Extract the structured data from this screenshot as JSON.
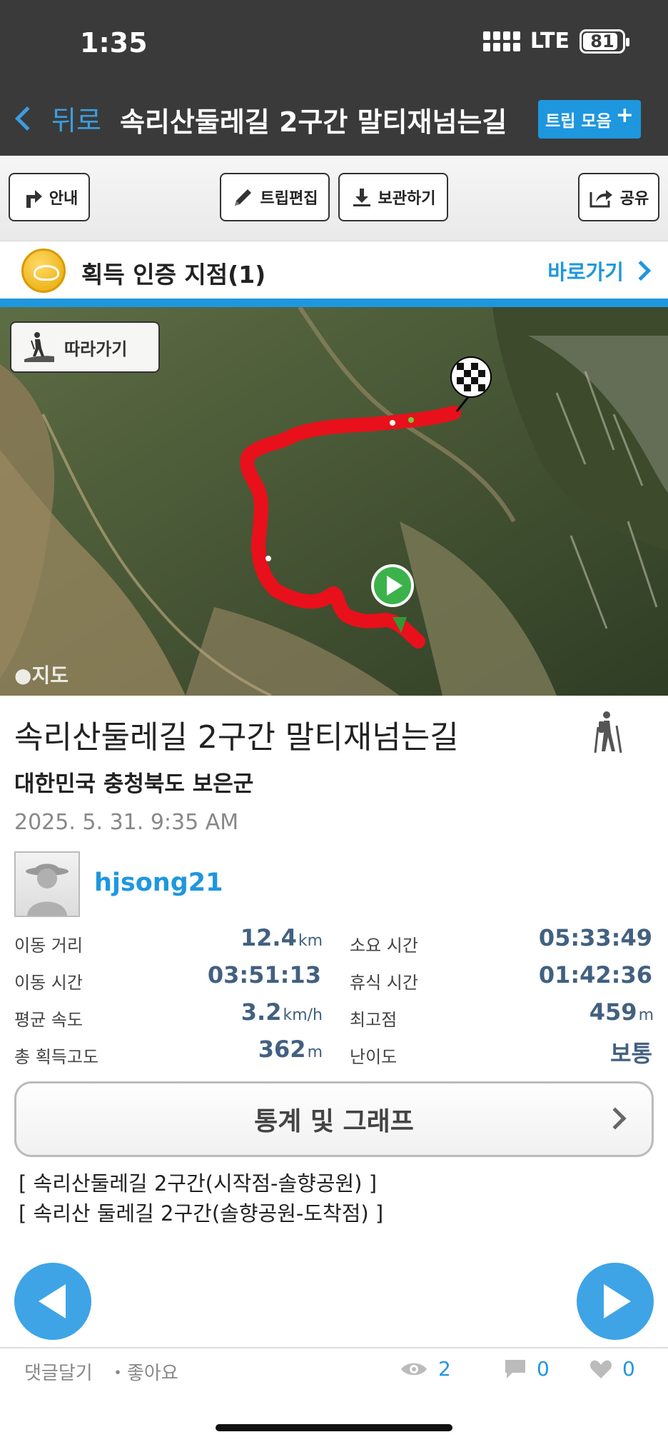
{
  "status_bar": {
    "time": "1:35",
    "network": "LTE",
    "battery": "81"
  },
  "nav": {
    "back_label": "뒤로",
    "title": "속리산둘레길 2구간 말티재넘는길",
    "trip_collect_label": "트립 모음"
  },
  "toolbar": {
    "guide_label": "안내",
    "edit_label": "트립편집",
    "save_label": "보관하기",
    "share_label": "공유"
  },
  "cert": {
    "label": "획득 인증 지점(1)",
    "go_label": "바로가기"
  },
  "map": {
    "follow_label": "따라가기",
    "credit": "지도"
  },
  "trip": {
    "title": "속리산둘레길 2구간 말티재넘는길",
    "region": "대한민국 충청북도 보은군",
    "date": "2025. 5. 31. 9:35 AM",
    "username": "hjsong21"
  },
  "stats": [
    {
      "left_label": "이동 거리",
      "left_value": "12.4",
      "left_unit": "km",
      "right_label": "소요 시간",
      "right_value": "05:33:49",
      "right_unit": ""
    },
    {
      "left_label": "이동 시간",
      "left_value": "03:51:13",
      "left_unit": "",
      "right_label": "휴식 시간",
      "right_value": "01:42:36",
      "right_unit": ""
    },
    {
      "left_label": "평균 속도",
      "left_value": "3.2",
      "left_unit": "km/h",
      "right_label": "최고점",
      "right_value": "459",
      "right_unit": "m"
    },
    {
      "left_label": "총 획득고도",
      "left_value": "362",
      "left_unit": "m",
      "right_label": "난이도",
      "right_value": "보통",
      "right_unit": ""
    }
  ],
  "graph_button_label": "통계 및 그래프",
  "sub_links": [
    "[ 속리산둘레길 2구간(시작점-솔향공원) ]",
    "[ 속리산 둘레길 2구간(솔향공원-도착점) ]"
  ],
  "footer": {
    "comment_label": "댓글달기",
    "like_label": "・좋아요",
    "views": "2",
    "comments": "0",
    "likes": "0"
  },
  "colors": {
    "accent": "#1f97df",
    "route": "#e8101a",
    "topbar": "#3a3a3a"
  }
}
